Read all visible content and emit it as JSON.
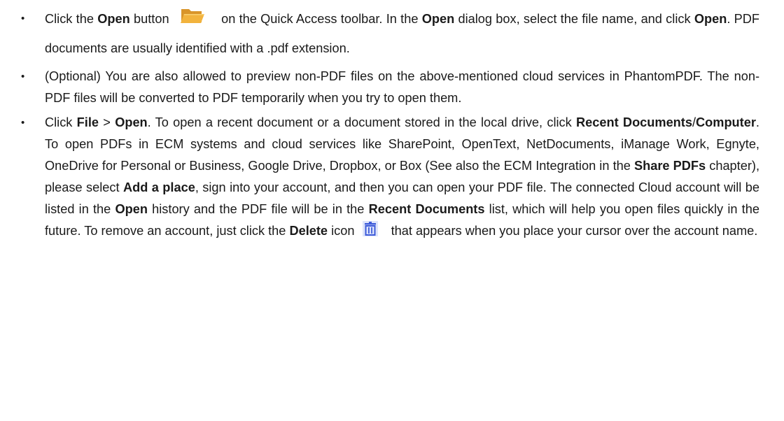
{
  "bullet_char": "•",
  "icons": {
    "open_button_icon": "folder-open-icon",
    "delete_icon": "trash-icon",
    "folder_color": "#f2b33d",
    "folder_back_color": "#d9952a",
    "trash_color": "#3d5bd9",
    "trash_bg": "#dde4fb"
  },
  "bullets": [
    {
      "t1": "Click the ",
      "b1": "Open",
      "t2": " button ",
      "t3": " on the Quick Access toolbar. In the ",
      "b2": "Open",
      "t4": " dialog box, select the file name, and click ",
      "b3": "Open",
      "t5": ". PDF documents are usually identified with a .pdf extension."
    },
    {
      "t1": "(Optional) You are also allowed to preview non-PDF files on the above-mentioned cloud services in PhantomPDF. The non-PDF files will be converted to PDF temporarily when you try to open them."
    },
    {
      "t1": "Click ",
      "b1": "File",
      "t2": " > ",
      "b2": "Open",
      "t3": ". To open a recent document or a document stored in the local drive, click ",
      "b3": "Recent Documents",
      "t4": "/",
      "b4": "Computer",
      "t5": ". To open PDFs in ECM systems and cloud services like SharePoint, OpenText, NetDocuments, iManage Work, Egnyte, OneDrive for Personal or Business, Google Drive, Dropbox, or Box (See also the ECM Integration in the ",
      "b5": "Share PDFs",
      "t6": " chapter), please select ",
      "b6": "Add a place",
      "t7": ", sign into your account, and then you can open your PDF file. The connected Cloud account will be listed in the ",
      "b7": "Open",
      "t8": " history and the PDF file will be in the ",
      "b8": "Recent Documents",
      "t9": " list, which will help you open files quickly in the future. To remove an account, just click the ",
      "b9": "Delete",
      "t10": " icon ",
      "t11": " that appears when you place your cursor over the account name."
    }
  ]
}
